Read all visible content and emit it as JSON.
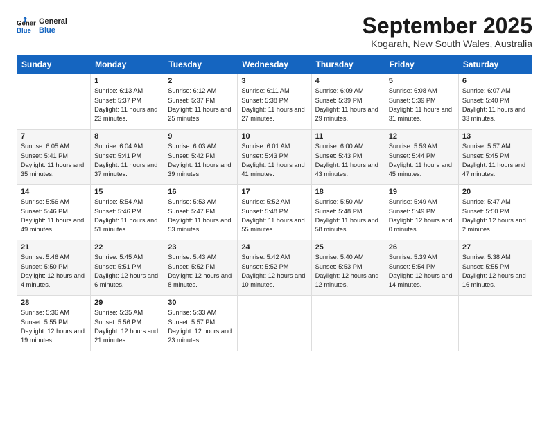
{
  "logo": {
    "line1": "General",
    "line2": "Blue"
  },
  "title": "September 2025",
  "subtitle": "Kogarah, New South Wales, Australia",
  "days_header": [
    "Sunday",
    "Monday",
    "Tuesday",
    "Wednesday",
    "Thursday",
    "Friday",
    "Saturday"
  ],
  "weeks": [
    [
      {
        "day": "",
        "sunrise": "",
        "sunset": "",
        "daylight": ""
      },
      {
        "day": "1",
        "sunrise": "Sunrise: 6:13 AM",
        "sunset": "Sunset: 5:37 PM",
        "daylight": "Daylight: 11 hours and 23 minutes."
      },
      {
        "day": "2",
        "sunrise": "Sunrise: 6:12 AM",
        "sunset": "Sunset: 5:37 PM",
        "daylight": "Daylight: 11 hours and 25 minutes."
      },
      {
        "day": "3",
        "sunrise": "Sunrise: 6:11 AM",
        "sunset": "Sunset: 5:38 PM",
        "daylight": "Daylight: 11 hours and 27 minutes."
      },
      {
        "day": "4",
        "sunrise": "Sunrise: 6:09 AM",
        "sunset": "Sunset: 5:39 PM",
        "daylight": "Daylight: 11 hours and 29 minutes."
      },
      {
        "day": "5",
        "sunrise": "Sunrise: 6:08 AM",
        "sunset": "Sunset: 5:39 PM",
        "daylight": "Daylight: 11 hours and 31 minutes."
      },
      {
        "day": "6",
        "sunrise": "Sunrise: 6:07 AM",
        "sunset": "Sunset: 5:40 PM",
        "daylight": "Daylight: 11 hours and 33 minutes."
      }
    ],
    [
      {
        "day": "7",
        "sunrise": "Sunrise: 6:05 AM",
        "sunset": "Sunset: 5:41 PM",
        "daylight": "Daylight: 11 hours and 35 minutes."
      },
      {
        "day": "8",
        "sunrise": "Sunrise: 6:04 AM",
        "sunset": "Sunset: 5:41 PM",
        "daylight": "Daylight: 11 hours and 37 minutes."
      },
      {
        "day": "9",
        "sunrise": "Sunrise: 6:03 AM",
        "sunset": "Sunset: 5:42 PM",
        "daylight": "Daylight: 11 hours and 39 minutes."
      },
      {
        "day": "10",
        "sunrise": "Sunrise: 6:01 AM",
        "sunset": "Sunset: 5:43 PM",
        "daylight": "Daylight: 11 hours and 41 minutes."
      },
      {
        "day": "11",
        "sunrise": "Sunrise: 6:00 AM",
        "sunset": "Sunset: 5:43 PM",
        "daylight": "Daylight: 11 hours and 43 minutes."
      },
      {
        "day": "12",
        "sunrise": "Sunrise: 5:59 AM",
        "sunset": "Sunset: 5:44 PM",
        "daylight": "Daylight: 11 hours and 45 minutes."
      },
      {
        "day": "13",
        "sunrise": "Sunrise: 5:57 AM",
        "sunset": "Sunset: 5:45 PM",
        "daylight": "Daylight: 11 hours and 47 minutes."
      }
    ],
    [
      {
        "day": "14",
        "sunrise": "Sunrise: 5:56 AM",
        "sunset": "Sunset: 5:46 PM",
        "daylight": "Daylight: 11 hours and 49 minutes."
      },
      {
        "day": "15",
        "sunrise": "Sunrise: 5:54 AM",
        "sunset": "Sunset: 5:46 PM",
        "daylight": "Daylight: 11 hours and 51 minutes."
      },
      {
        "day": "16",
        "sunrise": "Sunrise: 5:53 AM",
        "sunset": "Sunset: 5:47 PM",
        "daylight": "Daylight: 11 hours and 53 minutes."
      },
      {
        "day": "17",
        "sunrise": "Sunrise: 5:52 AM",
        "sunset": "Sunset: 5:48 PM",
        "daylight": "Daylight: 11 hours and 55 minutes."
      },
      {
        "day": "18",
        "sunrise": "Sunrise: 5:50 AM",
        "sunset": "Sunset: 5:48 PM",
        "daylight": "Daylight: 11 hours and 58 minutes."
      },
      {
        "day": "19",
        "sunrise": "Sunrise: 5:49 AM",
        "sunset": "Sunset: 5:49 PM",
        "daylight": "Daylight: 12 hours and 0 minutes."
      },
      {
        "day": "20",
        "sunrise": "Sunrise: 5:47 AM",
        "sunset": "Sunset: 5:50 PM",
        "daylight": "Daylight: 12 hours and 2 minutes."
      }
    ],
    [
      {
        "day": "21",
        "sunrise": "Sunrise: 5:46 AM",
        "sunset": "Sunset: 5:50 PM",
        "daylight": "Daylight: 12 hours and 4 minutes."
      },
      {
        "day": "22",
        "sunrise": "Sunrise: 5:45 AM",
        "sunset": "Sunset: 5:51 PM",
        "daylight": "Daylight: 12 hours and 6 minutes."
      },
      {
        "day": "23",
        "sunrise": "Sunrise: 5:43 AM",
        "sunset": "Sunset: 5:52 PM",
        "daylight": "Daylight: 12 hours and 8 minutes."
      },
      {
        "day": "24",
        "sunrise": "Sunrise: 5:42 AM",
        "sunset": "Sunset: 5:52 PM",
        "daylight": "Daylight: 12 hours and 10 minutes."
      },
      {
        "day": "25",
        "sunrise": "Sunrise: 5:40 AM",
        "sunset": "Sunset: 5:53 PM",
        "daylight": "Daylight: 12 hours and 12 minutes."
      },
      {
        "day": "26",
        "sunrise": "Sunrise: 5:39 AM",
        "sunset": "Sunset: 5:54 PM",
        "daylight": "Daylight: 12 hours and 14 minutes."
      },
      {
        "day": "27",
        "sunrise": "Sunrise: 5:38 AM",
        "sunset": "Sunset: 5:55 PM",
        "daylight": "Daylight: 12 hours and 16 minutes."
      }
    ],
    [
      {
        "day": "28",
        "sunrise": "Sunrise: 5:36 AM",
        "sunset": "Sunset: 5:55 PM",
        "daylight": "Daylight: 12 hours and 19 minutes."
      },
      {
        "day": "29",
        "sunrise": "Sunrise: 5:35 AM",
        "sunset": "Sunset: 5:56 PM",
        "daylight": "Daylight: 12 hours and 21 minutes."
      },
      {
        "day": "30",
        "sunrise": "Sunrise: 5:33 AM",
        "sunset": "Sunset: 5:57 PM",
        "daylight": "Daylight: 12 hours and 23 minutes."
      },
      {
        "day": "",
        "sunrise": "",
        "sunset": "",
        "daylight": ""
      },
      {
        "day": "",
        "sunrise": "",
        "sunset": "",
        "daylight": ""
      },
      {
        "day": "",
        "sunrise": "",
        "sunset": "",
        "daylight": ""
      },
      {
        "day": "",
        "sunrise": "",
        "sunset": "",
        "daylight": ""
      }
    ]
  ]
}
